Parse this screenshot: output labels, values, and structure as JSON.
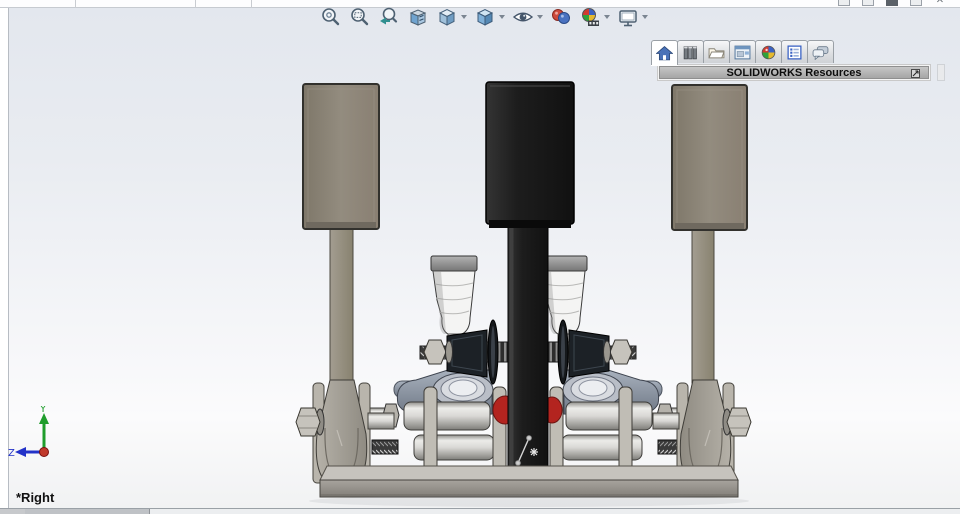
{
  "viewport": {
    "view_label": "*Right",
    "triad": {
      "axis_y": "Y",
      "axis_z": "Z",
      "y_color": "#1f9d2c",
      "z_color": "#2332c8",
      "origin_color": "#c0392b"
    },
    "background_top": "#e3e7ee",
    "background_bottom": "#fbfbfc"
  },
  "heads_up_toolbar": {
    "icons": [
      {
        "name": "zoom-to-fit-icon",
        "dropdown": false
      },
      {
        "name": "zoom-to-area-icon",
        "dropdown": false
      },
      {
        "name": "previous-view-icon",
        "dropdown": false
      },
      {
        "name": "section-view-icon",
        "dropdown": false
      },
      {
        "name": "view-orientation-icon",
        "dropdown": true
      },
      {
        "name": "display-style-icon",
        "dropdown": true
      },
      {
        "name": "hide-show-items-icon",
        "dropdown": true
      },
      {
        "name": "edit-appearance-icon",
        "dropdown": false
      },
      {
        "name": "apply-scene-icon",
        "dropdown": true
      },
      {
        "name": "view-settings-icon",
        "dropdown": true
      }
    ]
  },
  "task_pane": {
    "header": {
      "title": "SOLIDWORKS Resources",
      "flyout_icon": "pane-flyout-icon"
    },
    "tabs": [
      {
        "name": "tab-solidworks-resources",
        "icon": "home-icon",
        "active": true
      },
      {
        "name": "tab-design-library",
        "icon": "library-books-icon",
        "active": false
      },
      {
        "name": "tab-file-explorer",
        "icon": "folder-icon",
        "active": false
      },
      {
        "name": "tab-view-palette",
        "icon": "view-palette-window-icon",
        "active": false
      },
      {
        "name": "tab-appearances-scenes",
        "icon": "appearance-ball-icon",
        "active": false
      },
      {
        "name": "tab-custom-properties",
        "icon": "properties-form-icon",
        "active": false
      },
      {
        "name": "tab-solidworks-forum",
        "icon": "forum-chat-icon",
        "active": false
      }
    ]
  },
  "model": {
    "description": "pedal-box-assembly-right-view",
    "colors": {
      "pedal_pad_gray": "#8b8478",
      "pedal_pad_black": "#1c1c1c",
      "frame_gray": "#a8a49c",
      "cylinder_silver": "#d9d8d5",
      "knuckle_blue_gray": "#8a94a2",
      "reservoir_white": "#f4f4f3",
      "accent_red": "#b3241f"
    }
  }
}
